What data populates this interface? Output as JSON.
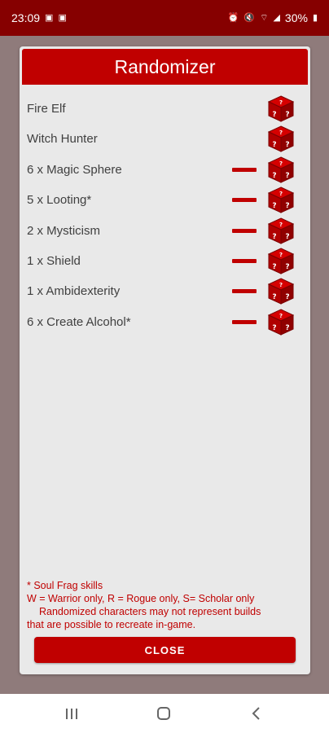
{
  "status_bar": {
    "time": "23:09",
    "battery": "30%"
  },
  "dialog": {
    "title": "Randomizer",
    "rows": [
      {
        "label": "Fire Elf",
        "removable": false
      },
      {
        "label": "Witch Hunter",
        "removable": false
      },
      {
        "label": "6 x Magic Sphere",
        "removable": true
      },
      {
        "label": "5 x Looting*",
        "removable": true
      },
      {
        "label": "2 x Mysticism",
        "removable": true
      },
      {
        "label": "1 x Shield",
        "removable": true
      },
      {
        "label": "1 x Ambidexterity",
        "removable": true
      },
      {
        "label": "6 x Create Alcohol*",
        "removable": true
      }
    ],
    "notes": {
      "line1": "* Soul Frag skills",
      "line2": "W = Warrior only, R = Rogue only, S= Scholar only",
      "line3": "Randomized characters may not represent builds",
      "line4": "that are possible to recreate in-game."
    },
    "close_label": "CLOSE"
  },
  "icons": {
    "dice": "dice-question-icon",
    "remove": "minus-icon",
    "nav_recents": "recent-apps-icon",
    "nav_home": "home-icon",
    "nav_back": "back-icon"
  },
  "colors": {
    "accent": "#c00000",
    "status_bar": "#860000",
    "dialog_bg": "#e9e9e9",
    "backdrop": "#8f7b7b"
  }
}
